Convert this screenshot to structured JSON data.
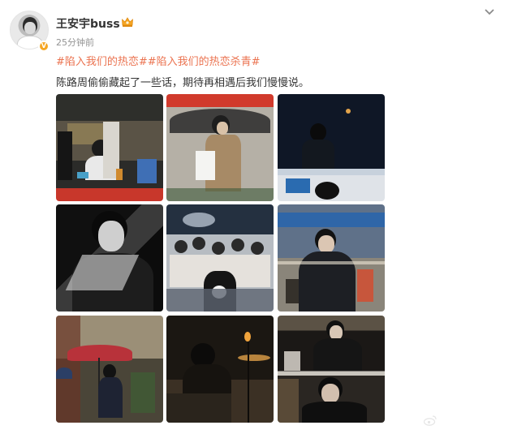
{
  "post": {
    "author": "王安宇buss",
    "time": "25分钟前",
    "hashtags": "#陷入我们的热恋##陷入我们的热恋杀青#",
    "text": "陈路周偷偷藏起了一些话，期待再相遇后我们慢慢说。",
    "verified_badge": "V"
  },
  "icons": {
    "member_crown": "crown-icon",
    "more": "chevron-down-icon",
    "watermark_logo": "weibo-logo"
  },
  "colors": {
    "hashtag": "#eb7350",
    "text": "#333333",
    "muted": "#939393",
    "badge": "#f5a623"
  },
  "photos": [
    {
      "name": "photo-1-filming-set",
      "dominant": "#3b3a35"
    },
    {
      "name": "photo-2-umbrella-notebook",
      "dominant": "#bfb8aa"
    },
    {
      "name": "photo-3-night-street",
      "dominant": "#1c2a3e"
    },
    {
      "name": "photo-4-bw-portrait",
      "dominant": "#1a1a1a"
    },
    {
      "name": "photo-5-fans-crowd",
      "dominant": "#9aa1a6"
    },
    {
      "name": "photo-6-bus-street",
      "dominant": "#4e5e78"
    },
    {
      "name": "photo-7-red-umbrella",
      "dominant": "#6e6552"
    },
    {
      "name": "photo-8-dark-street-lamps",
      "dominant": "#231d18"
    },
    {
      "name": "photo-9-suit-portrait",
      "dominant": "#2a2520"
    }
  ]
}
